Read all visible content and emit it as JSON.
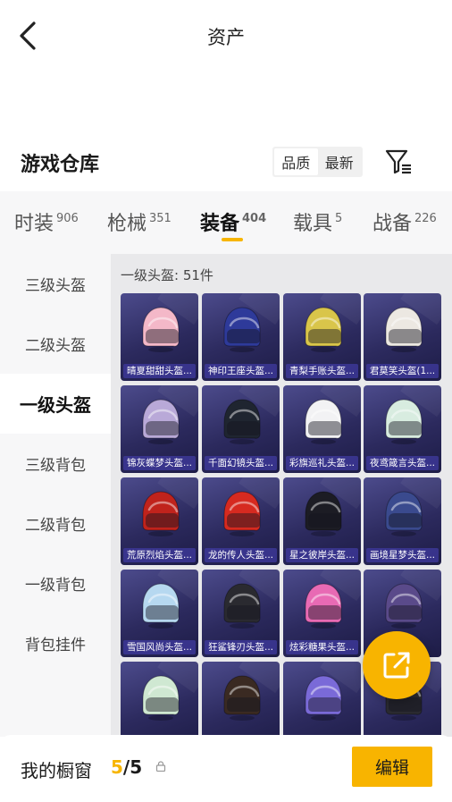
{
  "header": {
    "title": "资产"
  },
  "section": {
    "title": "游戏仓库"
  },
  "sort": {
    "options": [
      "品质",
      "最新"
    ]
  },
  "tabs": [
    {
      "label": "时装",
      "count": "906"
    },
    {
      "label": "枪械",
      "count": "351"
    },
    {
      "label": "装备",
      "count": "404"
    },
    {
      "label": "载具",
      "count": "5"
    },
    {
      "label": "战备",
      "count": "226"
    }
  ],
  "sidebar": {
    "items": [
      {
        "label": "三级头盔"
      },
      {
        "label": "二级头盔"
      },
      {
        "label": "一级头盔"
      },
      {
        "label": "三级背包"
      },
      {
        "label": "二级背包"
      },
      {
        "label": "一级背包"
      },
      {
        "label": "背包挂件"
      }
    ]
  },
  "grid": {
    "label": "一级头盔: 51件",
    "items": [
      {
        "name": "晴夏甜甜头盔...",
        "color": "#f4b8c8"
      },
      {
        "name": "神印王座头盔...",
        "color": "#2e3a9a"
      },
      {
        "name": "青梨手账头盔...",
        "color": "#d9c54a"
      },
      {
        "name": "君莫笑头盔(1...",
        "color": "#ece8e2"
      },
      {
        "name": "锦灰蝶梦头盔...",
        "color": "#b9a9d8"
      },
      {
        "name": "千面幻镜头盔...",
        "color": "#1f2530"
      },
      {
        "name": "彩旗巡礼头盔...",
        "color": "#f2f2f4"
      },
      {
        "name": "夜鸢箴言头盔...",
        "color": "#d8ece0"
      },
      {
        "name": "荒原烈焰头盔...",
        "color": "#c0231c"
      },
      {
        "name": "龙的传人头盔...",
        "color": "#d62a20"
      },
      {
        "name": "星之彼岸头盔...",
        "color": "#1c1c24"
      },
      {
        "name": "画境星梦头盔...",
        "color": "#3a4a8e"
      },
      {
        "name": "雪国风尚头盔...",
        "color": "#b6d8f0"
      },
      {
        "name": "狂鲨锋刃头盔...",
        "color": "#2a2a30"
      },
      {
        "name": "炫彩糖果头盔...",
        "color": "#e86ab4"
      },
      {
        "name": "",
        "color": "#5a4a8a"
      },
      {
        "name": "",
        "color": "#cfe8d2"
      },
      {
        "name": "",
        "color": "#3a2a22"
      },
      {
        "name": "",
        "color": "#7a6ad8"
      },
      {
        "name": "",
        "color": "#2a2a30"
      }
    ]
  },
  "footer": {
    "showcase_label": "我的橱窗",
    "showcase_current": "5",
    "showcase_total": "/5",
    "edit_label": "编辑"
  },
  "colors": {
    "accent": "#f8b400"
  }
}
